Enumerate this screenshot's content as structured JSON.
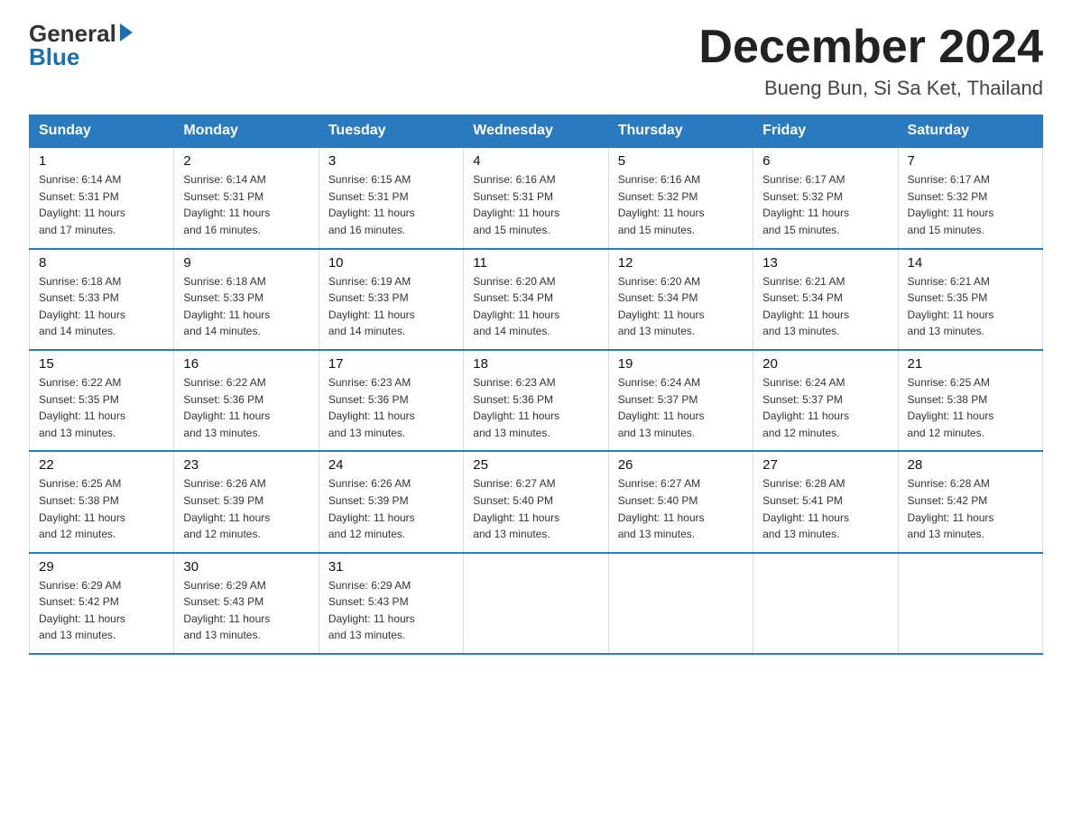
{
  "header": {
    "logo_line1": "General",
    "logo_line2": "Blue",
    "main_title": "December 2024",
    "subtitle": "Bueng Bun, Si Sa Ket, Thailand"
  },
  "calendar": {
    "days_of_week": [
      "Sunday",
      "Monday",
      "Tuesday",
      "Wednesday",
      "Thursday",
      "Friday",
      "Saturday"
    ],
    "weeks": [
      [
        {
          "day": "1",
          "sunrise": "6:14 AM",
          "sunset": "5:31 PM",
          "daylight": "11 hours and 17 minutes."
        },
        {
          "day": "2",
          "sunrise": "6:14 AM",
          "sunset": "5:31 PM",
          "daylight": "11 hours and 16 minutes."
        },
        {
          "day": "3",
          "sunrise": "6:15 AM",
          "sunset": "5:31 PM",
          "daylight": "11 hours and 16 minutes."
        },
        {
          "day": "4",
          "sunrise": "6:16 AM",
          "sunset": "5:31 PM",
          "daylight": "11 hours and 15 minutes."
        },
        {
          "day": "5",
          "sunrise": "6:16 AM",
          "sunset": "5:32 PM",
          "daylight": "11 hours and 15 minutes."
        },
        {
          "day": "6",
          "sunrise": "6:17 AM",
          "sunset": "5:32 PM",
          "daylight": "11 hours and 15 minutes."
        },
        {
          "day": "7",
          "sunrise": "6:17 AM",
          "sunset": "5:32 PM",
          "daylight": "11 hours and 15 minutes."
        }
      ],
      [
        {
          "day": "8",
          "sunrise": "6:18 AM",
          "sunset": "5:33 PM",
          "daylight": "11 hours and 14 minutes."
        },
        {
          "day": "9",
          "sunrise": "6:18 AM",
          "sunset": "5:33 PM",
          "daylight": "11 hours and 14 minutes."
        },
        {
          "day": "10",
          "sunrise": "6:19 AM",
          "sunset": "5:33 PM",
          "daylight": "11 hours and 14 minutes."
        },
        {
          "day": "11",
          "sunrise": "6:20 AM",
          "sunset": "5:34 PM",
          "daylight": "11 hours and 14 minutes."
        },
        {
          "day": "12",
          "sunrise": "6:20 AM",
          "sunset": "5:34 PM",
          "daylight": "11 hours and 13 minutes."
        },
        {
          "day": "13",
          "sunrise": "6:21 AM",
          "sunset": "5:34 PM",
          "daylight": "11 hours and 13 minutes."
        },
        {
          "day": "14",
          "sunrise": "6:21 AM",
          "sunset": "5:35 PM",
          "daylight": "11 hours and 13 minutes."
        }
      ],
      [
        {
          "day": "15",
          "sunrise": "6:22 AM",
          "sunset": "5:35 PM",
          "daylight": "11 hours and 13 minutes."
        },
        {
          "day": "16",
          "sunrise": "6:22 AM",
          "sunset": "5:36 PM",
          "daylight": "11 hours and 13 minutes."
        },
        {
          "day": "17",
          "sunrise": "6:23 AM",
          "sunset": "5:36 PM",
          "daylight": "11 hours and 13 minutes."
        },
        {
          "day": "18",
          "sunrise": "6:23 AM",
          "sunset": "5:36 PM",
          "daylight": "11 hours and 13 minutes."
        },
        {
          "day": "19",
          "sunrise": "6:24 AM",
          "sunset": "5:37 PM",
          "daylight": "11 hours and 13 minutes."
        },
        {
          "day": "20",
          "sunrise": "6:24 AM",
          "sunset": "5:37 PM",
          "daylight": "11 hours and 12 minutes."
        },
        {
          "day": "21",
          "sunrise": "6:25 AM",
          "sunset": "5:38 PM",
          "daylight": "11 hours and 12 minutes."
        }
      ],
      [
        {
          "day": "22",
          "sunrise": "6:25 AM",
          "sunset": "5:38 PM",
          "daylight": "11 hours and 12 minutes."
        },
        {
          "day": "23",
          "sunrise": "6:26 AM",
          "sunset": "5:39 PM",
          "daylight": "11 hours and 12 minutes."
        },
        {
          "day": "24",
          "sunrise": "6:26 AM",
          "sunset": "5:39 PM",
          "daylight": "11 hours and 12 minutes."
        },
        {
          "day": "25",
          "sunrise": "6:27 AM",
          "sunset": "5:40 PM",
          "daylight": "11 hours and 13 minutes."
        },
        {
          "day": "26",
          "sunrise": "6:27 AM",
          "sunset": "5:40 PM",
          "daylight": "11 hours and 13 minutes."
        },
        {
          "day": "27",
          "sunrise": "6:28 AM",
          "sunset": "5:41 PM",
          "daylight": "11 hours and 13 minutes."
        },
        {
          "day": "28",
          "sunrise": "6:28 AM",
          "sunset": "5:42 PM",
          "daylight": "11 hours and 13 minutes."
        }
      ],
      [
        {
          "day": "29",
          "sunrise": "6:29 AM",
          "sunset": "5:42 PM",
          "daylight": "11 hours and 13 minutes."
        },
        {
          "day": "30",
          "sunrise": "6:29 AM",
          "sunset": "5:43 PM",
          "daylight": "11 hours and 13 minutes."
        },
        {
          "day": "31",
          "sunrise": "6:29 AM",
          "sunset": "5:43 PM",
          "daylight": "11 hours and 13 minutes."
        },
        null,
        null,
        null,
        null
      ]
    ],
    "labels": {
      "sunrise": "Sunrise:",
      "sunset": "Sunset:",
      "daylight": "Daylight:"
    }
  }
}
